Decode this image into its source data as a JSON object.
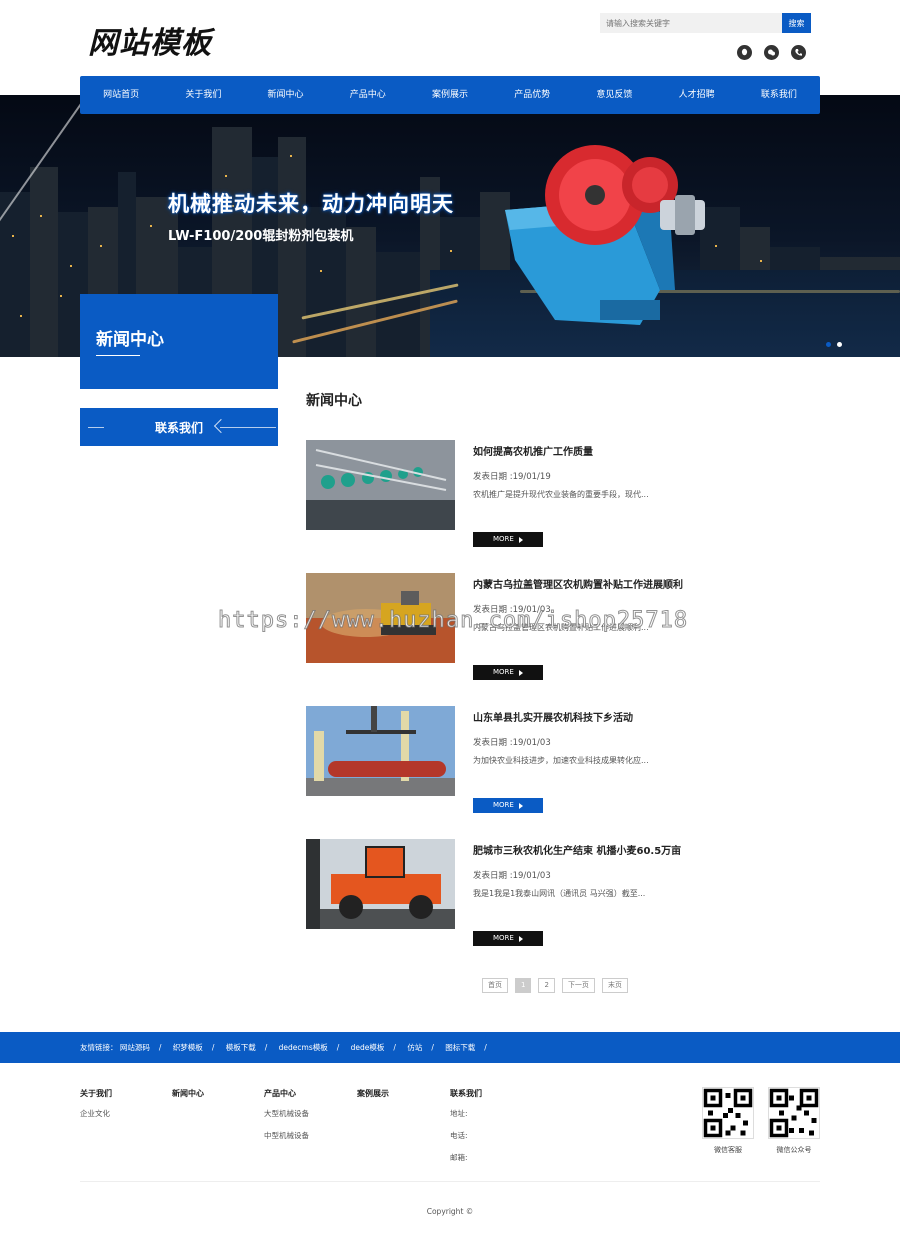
{
  "header": {
    "logo": "网站模板",
    "search_placeholder": "请输入搜索关键字",
    "search_button": "搜索",
    "social_icons": [
      "qq-icon",
      "wechat-icon",
      "phone-icon"
    ]
  },
  "nav": [
    "网站首页",
    "关于我们",
    "新闻中心",
    "产品中心",
    "案例展示",
    "产品优势",
    "意见反馈",
    "人才招聘",
    "联系我们"
  ],
  "banner": {
    "title": "机械推动未来，动力冲向明天",
    "subtitle": "LW-F100/200辊封粉剂包装机"
  },
  "sidebar": {
    "title": "新闻中心",
    "contact": "联系我们"
  },
  "main": {
    "title": "新闻中心",
    "more_label": "MORE",
    "news": [
      {
        "title": "如何提高农机推广工作质量",
        "date": "发表日期 :19/01/19",
        "desc": "农机推广是提升现代农业装备的重要手段，现代..."
      },
      {
        "title": "内蒙古乌拉盖管理区农机购置补贴工作进展顺利",
        "date": "发表日期 :19/01/03",
        "desc": "内蒙古乌拉盖管理区农机购置补贴工作进展顺利..."
      },
      {
        "title": "山东单县扎实开展农机科技下乡活动",
        "date": "发表日期 :19/01/03",
        "desc": "为加快农业科技进步，加速农业科技成果转化应..."
      },
      {
        "title": "肥城市三秋农机化生产结束 机播小麦60.5万亩",
        "date": "发表日期 :19/01/03",
        "desc": "我是1我是1我泰山网讯（通讯员 马兴强）截至..."
      }
    ]
  },
  "pager": [
    "首页",
    "1",
    "2",
    "下一页",
    "末页"
  ],
  "links": {
    "label": "友情链接：",
    "items": [
      "网站源码",
      "织梦模板",
      "模板下载",
      "dedecms模板",
      "dede模板",
      "仿站",
      "图标下载"
    ]
  },
  "footer": {
    "cols": [
      {
        "title": "关于我们",
        "items": [
          "企业文化"
        ]
      },
      {
        "title": "新闻中心",
        "items": []
      },
      {
        "title": "产品中心",
        "items": [
          "大型机械设备",
          "中型机械设备"
        ]
      },
      {
        "title": "案例展示",
        "items": []
      },
      {
        "title": "联系我们",
        "items": [
          "地址:",
          "电话:",
          "邮箱:"
        ]
      }
    ],
    "qr_captions": [
      "微信客服",
      "微信公众号"
    ],
    "copyright": "Copyright ©"
  },
  "watermark": "https://www.huzhan.com/ishop25718",
  "colors": {
    "brand": "#0a5bc4",
    "dark": "#111111"
  }
}
